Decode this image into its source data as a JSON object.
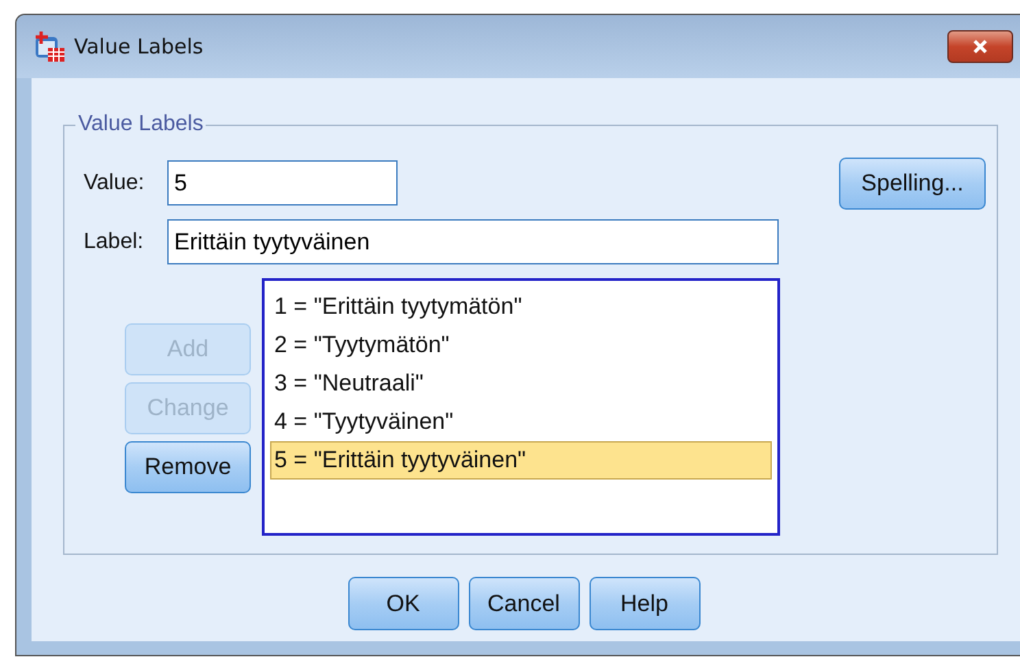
{
  "window": {
    "title": "Value Labels"
  },
  "group": {
    "title": "Value Labels"
  },
  "value_field": {
    "label": "Value:",
    "value": "5"
  },
  "label_field": {
    "label": "Label:",
    "value": "Erittäin tyytyväinen"
  },
  "spelling_button": {
    "label": "Spelling..."
  },
  "side_buttons": [
    {
      "label": "Add",
      "disabled": true
    },
    {
      "label": "Change",
      "disabled": true
    },
    {
      "label": "Remove",
      "disabled": false
    }
  ],
  "list": [
    {
      "text": "1 = \"Erittäin tyytymätön\"",
      "selected": false
    },
    {
      "text": "2 = \"Tyytymätön\"",
      "selected": false
    },
    {
      "text": "3 = \"Neutraali\"",
      "selected": false
    },
    {
      "text": "4 = \"Tyytyväinen\"",
      "selected": false
    },
    {
      "text": "5 = \"Erittäin tyytyväinen\"",
      "selected": true
    }
  ],
  "buttons": [
    "OK",
    "Cancel",
    "Help"
  ]
}
